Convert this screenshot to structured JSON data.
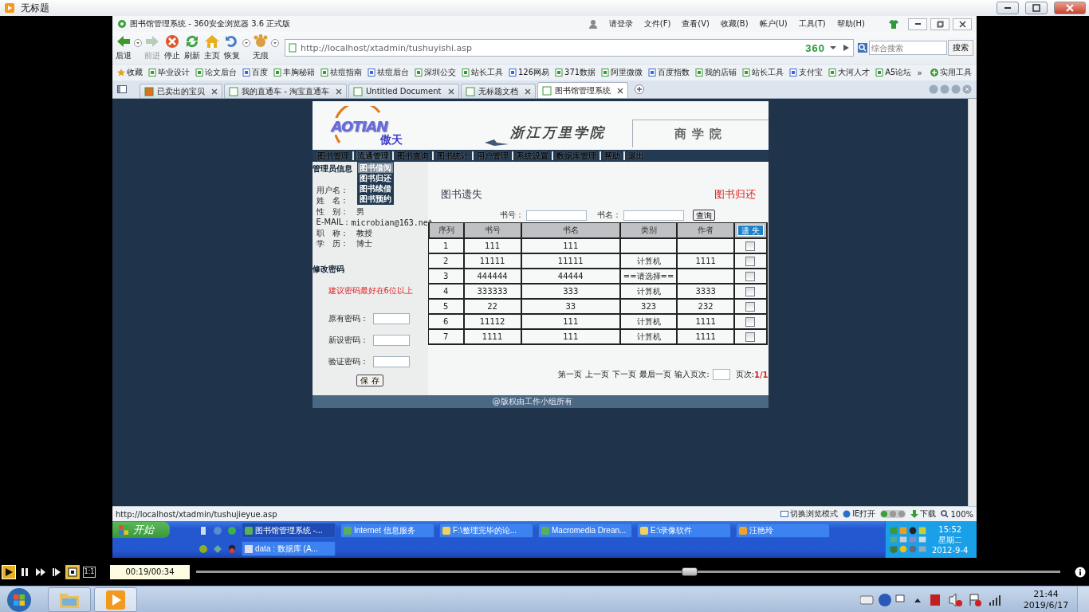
{
  "player": {
    "title": "无标题",
    "ratio_key": "1:1",
    "time": "00:19/00:34",
    "seek": {
      "level": 0.57
    }
  },
  "browser": {
    "title": "图书馆管理系统 - 360安全浏览器 3.6 正式版",
    "menu": [
      "请登录",
      "文件(F)",
      "查看(V)",
      "收藏(B)",
      "帐户(U)",
      "工具(T)",
      "帮助(H)"
    ],
    "nav_buttons": [
      {
        "kind": "back",
        "label": "后退",
        "disabled": false
      },
      {
        "kind": "forward",
        "label": "前进",
        "disabled": true
      },
      {
        "kind": "stop",
        "label": "停止",
        "disabled": false
      },
      {
        "kind": "refresh",
        "label": "刷新",
        "disabled": false
      },
      {
        "kind": "home",
        "label": "主页",
        "disabled": false
      },
      {
        "kind": "restore",
        "label": "恢复",
        "disabled": false
      },
      {
        "kind": "incognito",
        "label": "无痕",
        "disabled": false
      }
    ],
    "address": "http://localhost/xtadmin/tushuyishi.asp",
    "badge": "360",
    "search": {
      "placeholder": "综合搜索",
      "button": "搜索"
    },
    "bookmarks": [
      "收藏",
      "毕业设计",
      "论文后台",
      "百度",
      "丰胸秘籍",
      "祛痘指南",
      "祛痘后台",
      "深圳公交",
      "站长工具",
      "126网易",
      "371数据",
      "阿里微微",
      "百度指数",
      "我的店铺",
      "站长工具",
      "支付宝",
      "大河人才",
      "A5论坛"
    ],
    "more": "»",
    "tools": "实用工具",
    "tabs": [
      {
        "label": "已卖出的宝贝",
        "selected": false
      },
      {
        "label": "我的直通车 - 淘宝直通车",
        "selected": false
      },
      {
        "label": "Untitled Document",
        "selected": false
      },
      {
        "label": "无标题文档",
        "selected": false
      },
      {
        "label": "图书馆管理系统",
        "selected": true
      }
    ],
    "status_url": "http://localhost/xtadmin/tushujieyue.asp",
    "status_items": [
      "切换浏览模式",
      "IE打开",
      "下载",
      "100%"
    ]
  },
  "page": {
    "logo": "AOTIAN",
    "logo_sub": "傲天",
    "school": "浙江万里学院",
    "college": "商学院",
    "nav": [
      {
        "label": "图书管理",
        "expanded": false
      },
      {
        "label": "流通管理",
        "expanded": true,
        "children": [
          {
            "label": "图书借阅",
            "highlighted": true
          },
          {
            "label": "图书归还",
            "highlighted": false
          },
          {
            "label": "图书续借",
            "highlighted": false
          },
          {
            "label": "图书预约",
            "highlighted": false
          }
        ]
      },
      {
        "label": "图书查询",
        "expanded": false
      },
      {
        "label": "图书统计",
        "expanded": false
      },
      {
        "label": "用户管理",
        "expanded": false
      },
      {
        "label": "系统设置",
        "expanded": false
      },
      {
        "label": "数据库管理",
        "expanded": false
      },
      {
        "label": "帮助",
        "expanded": false
      },
      {
        "label": "退出",
        "expanded": false
      }
    ],
    "admin_title": "管理员信息",
    "admin_fields": [
      {
        "label": "用户名："
      },
      {
        "label": "姓　名："
      },
      {
        "label": "性　别：",
        "value": "男"
      },
      {
        "label": "E-MAIL：",
        "value": "microbian@163.net"
      },
      {
        "label": "职　称：",
        "value": "教授"
      },
      {
        "label": "学　历：",
        "value": "博士"
      }
    ],
    "password_title": "修改密码",
    "password_hint": "建议密码最好在6位以上",
    "password_fields": [
      "原有密码：",
      "新设密码：",
      "验证密码："
    ],
    "save": "保 存",
    "heading": "图书遗失",
    "return_link": "图书归还",
    "search_fields": [
      "书号：",
      "书名："
    ],
    "search_button": "查询",
    "table": {
      "columns": [
        "序列",
        "书号",
        "书名",
        "类别",
        "作者"
      ],
      "action_column": "遗 失",
      "rows": [
        {
          "cells": [
            "1",
            "111",
            "111",
            "",
            ""
          ],
          "checked": false
        },
        {
          "cells": [
            "2",
            "11111",
            "11111",
            "计算机",
            "1111"
          ],
          "checked": false
        },
        {
          "cells": [
            "3",
            "444444",
            "44444",
            "==请选择==",
            ""
          ],
          "checked": false
        },
        {
          "cells": [
            "4",
            "333333",
            "333",
            "计算机",
            "3333"
          ],
          "checked": false
        },
        {
          "cells": [
            "5",
            "22",
            "33",
            "323",
            "232"
          ],
          "checked": false
        },
        {
          "cells": [
            "6",
            "11112",
            "111",
            "计算机",
            "1111"
          ],
          "checked": false
        },
        {
          "cells": [
            "7",
            "1111",
            "111",
            "计算机",
            "1111"
          ],
          "checked": false
        }
      ]
    },
    "pager": [
      "第一页",
      "上一页",
      "下一页",
      "最后一页"
    ],
    "page_input": "输入页次:",
    "page_label": "页次:",
    "page_value": "1/1",
    "footer": "@版权由工作小组所有"
  },
  "xp_taskbar": {
    "start": "开始",
    "tasks": [
      {
        "label": "图书馆管理系统 -...",
        "selected": true
      },
      {
        "label": "Internet 信息服务",
        "selected": false
      },
      {
        "label": "F:\\整理完毕的论...",
        "selected": false
      },
      {
        "label": "Macromedia Drean...",
        "selected": false
      },
      {
        "label": "E:\\录像软件",
        "selected": false
      },
      {
        "label": "汪艳玲",
        "selected": false
      }
    ],
    "tasks_row2": [
      {
        "label": "data : 数据库 (A...",
        "selected": false
      }
    ],
    "time": "15:52",
    "weekday": "星期二",
    "date": "2012-9-4"
  },
  "clock": {
    "time": "21:44",
    "date": "2019/6/17"
  }
}
